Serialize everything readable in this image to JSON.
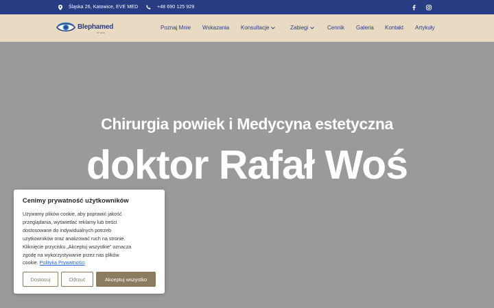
{
  "topbar": {
    "address": "Śląska 26, Katowice, EVE MED",
    "phone": "+48 690 125 929",
    "background": "#283c84"
  },
  "nav": {
    "logo_main": "Blephamed",
    "logo_sub": "dr wos",
    "items": [
      {
        "label": "Poznaj Mnie"
      },
      {
        "label": "Wskazania"
      },
      {
        "label": "Konsultacje"
      },
      {
        "label": "Zabiegi"
      },
      {
        "label": "Cennik"
      },
      {
        "label": "Galeria"
      },
      {
        "label": "Kontakt"
      },
      {
        "label": "Artykuły"
      }
    ],
    "background": "#e8dac3",
    "text_color": "#283c84"
  },
  "hero": {
    "subtitle": "Chirurgia powiek i Medycyna estetyczna",
    "title": "doktor Rafał Woś"
  },
  "cookie": {
    "title": "Cenimy prywatność użytkowników",
    "lines": [
      "Używamy plików cookie, aby poprawić jakość",
      "przeglądania, wyświetlać reklamy lub treści",
      "dostosowane do indywidualnych potrzeb",
      "użytkowników oraz analizować ruch na stronie.",
      "Kliknięcie przycisku „Akceptuj wszystkie” oznacza",
      "zgodę na wykorzystywanie przez nas plików"
    ],
    "last_line_prefix": "cookie.",
    "policy_link": "Polityka Prywatności",
    "buttons": {
      "customize": "Dostosuj",
      "reject": "Odrzuć",
      "accept": "Akceptuj wszystko"
    },
    "accent": "#8b7b60"
  }
}
